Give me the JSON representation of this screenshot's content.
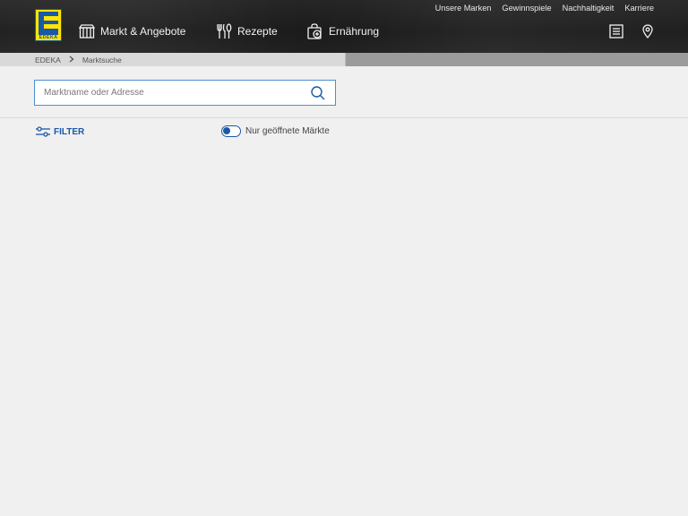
{
  "header": {
    "logo_text": "EDEKA",
    "nav": [
      {
        "label": "Markt & Angebote",
        "icon": "store-icon"
      },
      {
        "label": "Rezepte",
        "icon": "cutlery-icon"
      },
      {
        "label": "Ernährung",
        "icon": "shopping-bag-icon"
      }
    ],
    "top_links": [
      "Unsere Marken",
      "Gewinnspiele",
      "Nachhaltigkeit",
      "Karriere"
    ],
    "icons": [
      "shopping-list-icon",
      "location-pin-icon"
    ]
  },
  "breadcrumb": {
    "items": [
      "EDEKA",
      "Marktsuche"
    ]
  },
  "search": {
    "value": "",
    "placeholder": "Marktname oder Adresse"
  },
  "filter": {
    "label": "FILTER"
  },
  "toggle": {
    "label": "Nur geöffnete Märkte",
    "state": "off"
  },
  "colors": {
    "brand_blue": "#1a58a8",
    "brand_yellow": "#ffe500",
    "header_bg": "#232323"
  }
}
